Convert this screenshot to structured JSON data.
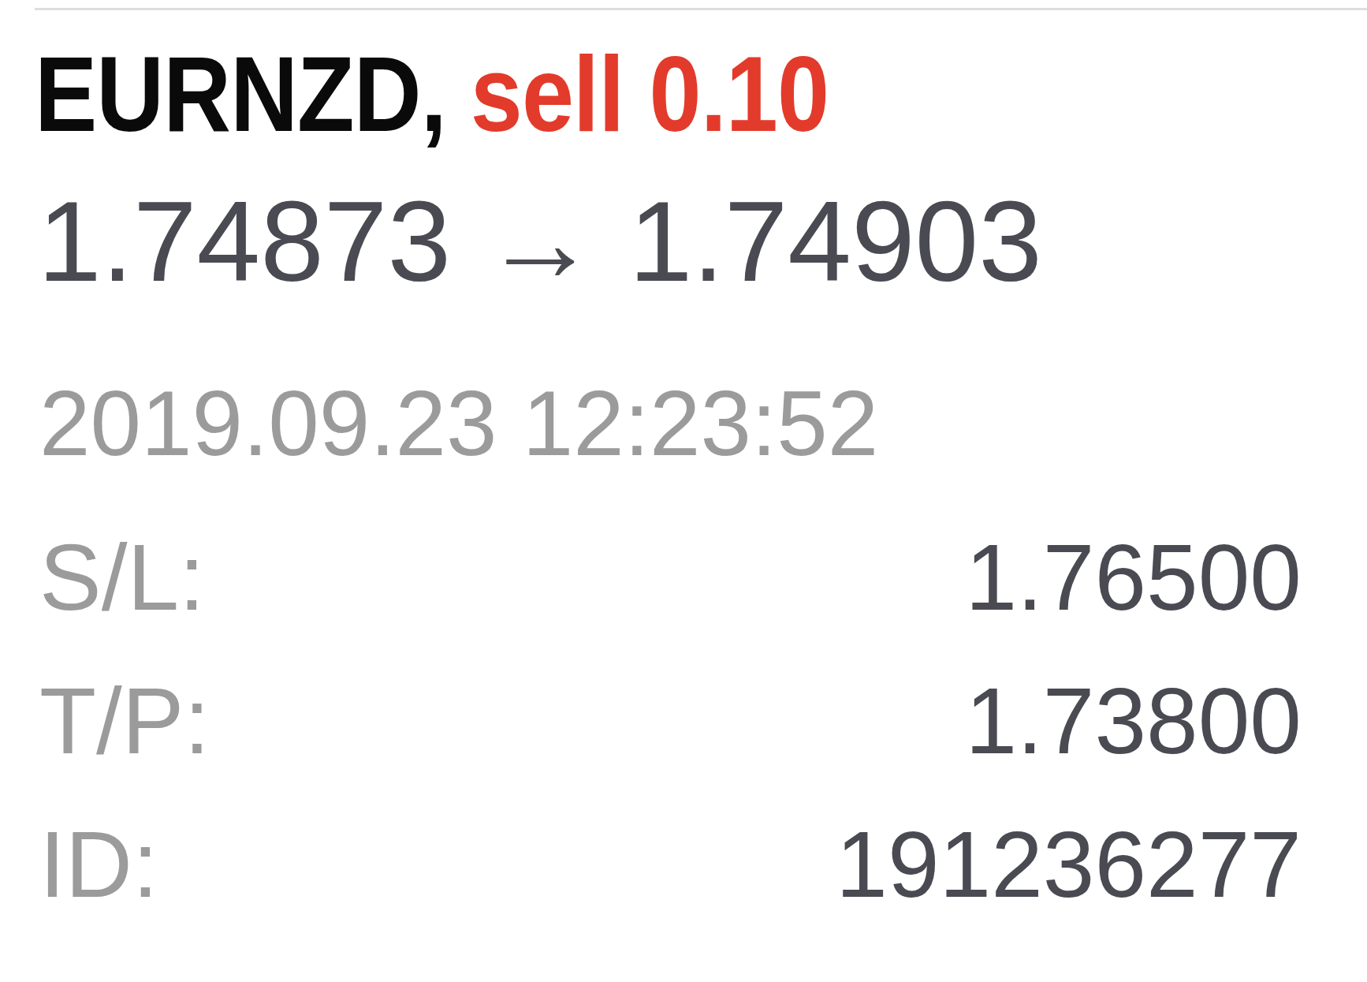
{
  "position": {
    "title": [
      {
        "text": "EURNZD,",
        "color": "#0a0a0a"
      },
      {
        "text": "sell 0.10",
        "color": "#e23b2b"
      }
    ],
    "prices": "1.74873 → 1.74903",
    "time": "2019.09.23 12:23:52",
    "details": [
      {
        "label": "S/L:",
        "value": "1.76500"
      },
      {
        "label": "T/P:",
        "value": "1.73800"
      },
      {
        "label": "ID:",
        "value": "191236277"
      }
    ]
  }
}
